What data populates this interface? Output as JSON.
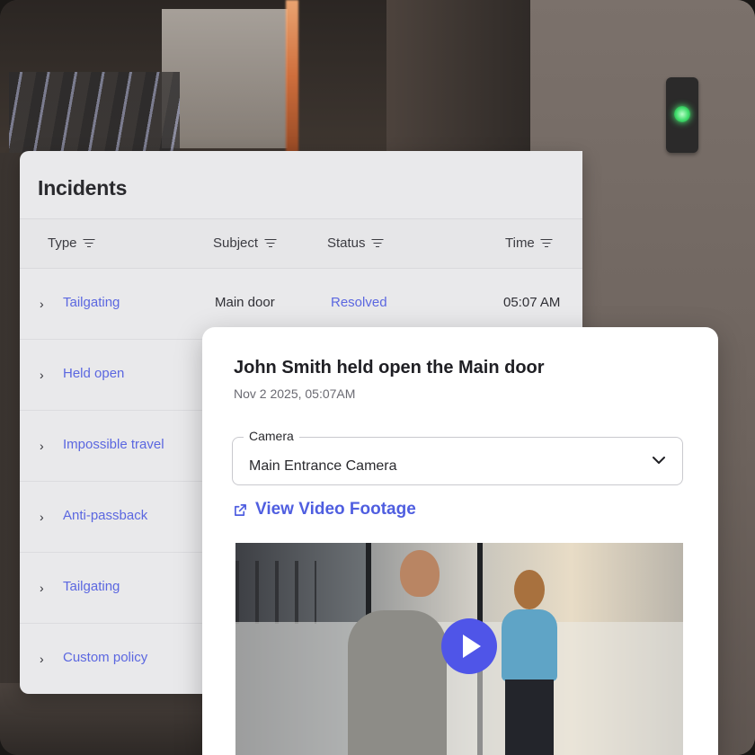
{
  "incidents": {
    "title": "Incidents",
    "columns": {
      "type": "Type",
      "subject": "Subject",
      "status": "Status",
      "time": "Time"
    },
    "rows": [
      {
        "type": "Tailgating",
        "subject": "Main door",
        "status": "Resolved",
        "time": "05:07 AM"
      },
      {
        "type": "Held open",
        "subject": "",
        "status": "",
        "time": ""
      },
      {
        "type": "Impossible travel",
        "subject": "",
        "status": "",
        "time": ""
      },
      {
        "type": "Anti-passback",
        "subject": "",
        "status": "",
        "time": ""
      },
      {
        "type": "Tailgating",
        "subject": "",
        "status": "",
        "time": ""
      },
      {
        "type": "Custom policy",
        "subject": "",
        "status": "",
        "time": ""
      }
    ]
  },
  "detail": {
    "title": "John Smith held open the Main door",
    "timestamp": "Nov 2 2025, 05:07AM",
    "camera_label": "Camera",
    "camera_value": "Main Entrance Camera",
    "view_footage": "View Video Footage"
  },
  "colors": {
    "accent": "#4f5ee0",
    "play_button": "#4f55e8",
    "led": "#3fdc6a"
  },
  "icons": [
    "filter-icon",
    "chevron-right-icon",
    "chevron-down-icon",
    "external-link-icon",
    "play-icon"
  ]
}
